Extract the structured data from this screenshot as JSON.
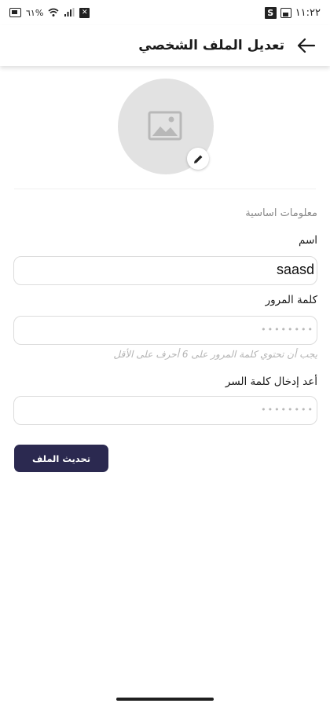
{
  "status_bar": {
    "time": "١١:٢٢",
    "battery_text": "٦١%",
    "icons": [
      "battery-icon",
      "wifi-icon",
      "signal-icon",
      "mute-icon",
      "s-app-icon",
      "image-notification-icon"
    ]
  },
  "header": {
    "title": "تعديل الملف الشخصي",
    "back_icon": "arrow-back-icon"
  },
  "avatar": {
    "placeholder_icon": "image-placeholder-icon",
    "edit_icon": "pencil-icon"
  },
  "form": {
    "section_heading": "معلومات اساسية",
    "name_label": "اسم",
    "name_value": "saasd",
    "password_label": "كلمة المرور",
    "password_mask": "••••••••",
    "password_hint": "يجب أن تحتوي كلمة المرور على 6 أحرف على الأقل",
    "confirm_label": "أعد إدخال كلمة السر",
    "confirm_mask": "••••••••"
  },
  "actions": {
    "update_label": "تحديث الملف"
  },
  "colors": {
    "button_bg": "#2b2950",
    "avatar_bg": "#e2e2e2",
    "border": "#dcdcdc"
  }
}
